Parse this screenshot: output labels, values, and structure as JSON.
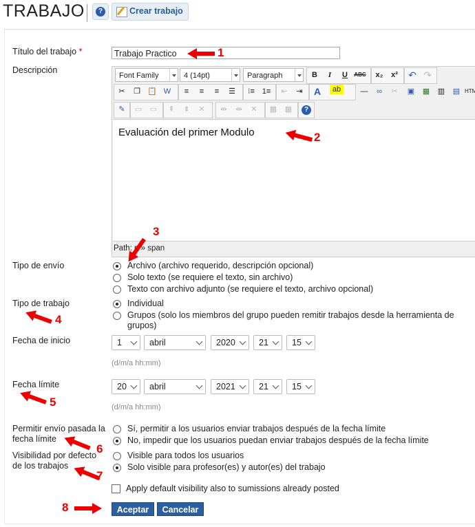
{
  "header": {
    "title": "TRABAJO",
    "help_label": "?",
    "create_label": "Crear trabajo"
  },
  "form": {
    "title_label": "Título del trabajo",
    "required_mark": "*",
    "title_value": "Trabajo Practico",
    "description_label": "Descripción",
    "editor": {
      "font_family": "Font Family",
      "font_size": "4 (14pt)",
      "format": "Paragraph",
      "content": "Evaluación del primer Modulo",
      "path": "Path: p » span"
    },
    "submission_type": {
      "label": "Tipo de envío",
      "options": [
        "Archivo (archivo requerido, descripción opcional)",
        "Solo texto (se requiere el texto, sin archivo)",
        "Texto con archivo adjunto (se requiere el texto, archivo opcional)"
      ],
      "selected": 0
    },
    "work_type": {
      "label": "Tipo de trabajo",
      "options": [
        "Individual",
        "Grupos (solo los miembros del grupo pueden remitir trabajos desde la herramienta de grupos)"
      ],
      "selected": 0
    },
    "start_date": {
      "label": "Fecha de inicio",
      "day": "1",
      "month": "abril",
      "year": "2020",
      "hour": "21",
      "minute": "15",
      "hint": "(d/m/a hh:mm)"
    },
    "end_date": {
      "label": "Fecha límite",
      "day": "20",
      "month": "abril",
      "year": "2021",
      "hour": "21",
      "minute": "15",
      "hint": "(d/m/a hh:mm)"
    },
    "late_submission": {
      "label": "Permitir envío pasada la fecha límite",
      "options": [
        "Sí, permitir a los usuarios enviar trabajos después de la fecha límite",
        "No, impedir que los usuarios puedan enviar trabajos después de la fecha límite"
      ],
      "selected": 1
    },
    "visibility": {
      "label": "Visibilidad por defecto de los trabajos",
      "options": [
        "Visible para todos los usuarios",
        "Solo visible para profesor(es) y autor(es) del trabajo"
      ],
      "selected": 1
    },
    "apply_visibility_label": "Apply default visibility also to sumissions already posted",
    "accept_label": "Aceptar",
    "cancel_label": "Cancelar"
  },
  "annotations": [
    "1",
    "2",
    "3",
    "4",
    "5",
    "6",
    "7",
    "8"
  ],
  "colors": {
    "accent": "#2c5f9e",
    "annotation": "#ee0000"
  }
}
